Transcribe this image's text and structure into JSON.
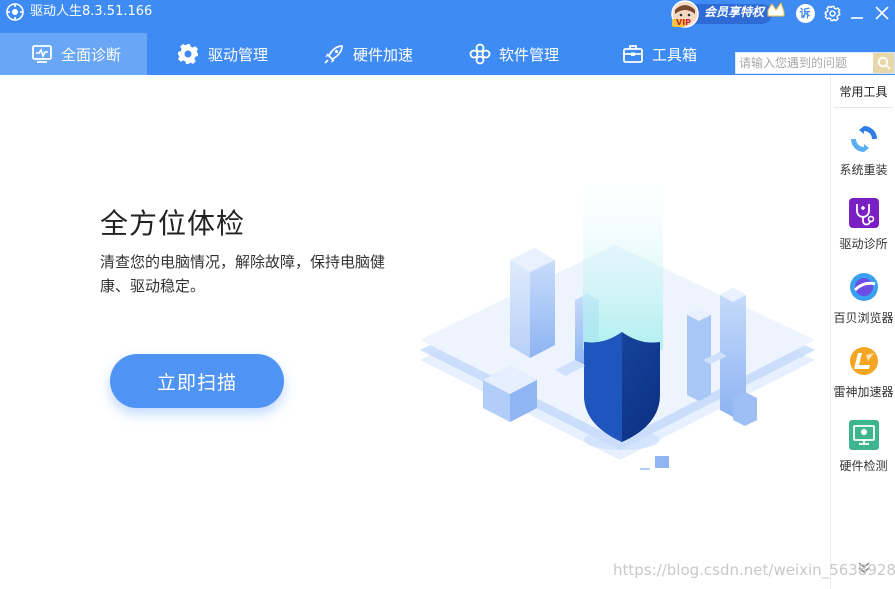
{
  "app": {
    "title": "驱动人生8.3.51.166"
  },
  "vip": {
    "label": "会员享特权",
    "badge": "VIP"
  },
  "window_controls": {
    "service_badge": "诉"
  },
  "tabs": [
    {
      "label": "全面诊断",
      "icon": "monitor-check-icon",
      "active": true
    },
    {
      "label": "驱动管理",
      "icon": "gear-icon",
      "active": false
    },
    {
      "label": "硬件加速",
      "icon": "rocket-icon",
      "active": false
    },
    {
      "label": "软件管理",
      "icon": "flower-apps-icon",
      "active": false
    },
    {
      "label": "工具箱",
      "icon": "toolbox-icon",
      "active": false
    }
  ],
  "search": {
    "placeholder": "请输入您遇到的问题",
    "value": ""
  },
  "main": {
    "headline": "全方位体检",
    "description": "清查您的电脑情况，解除故障，保持电脑健康、驱动稳定。",
    "scan_button": "立即扫描"
  },
  "sidebar": {
    "title": "常用工具",
    "tools": [
      {
        "label": "系统重装",
        "icon": "system-reinstall-icon"
      },
      {
        "label": "驱动诊所",
        "icon": "driver-clinic-icon"
      },
      {
        "label": "百贝浏览器",
        "icon": "browser-icon"
      },
      {
        "label": "雷神加速器",
        "icon": "leishen-accelerator-icon"
      },
      {
        "label": "硬件检测",
        "icon": "hardware-check-icon"
      }
    ]
  },
  "watermark": "https://blog.csdn.net/weixin_5638928",
  "colors": {
    "header": "#3f8bf4",
    "active_tab": "#6aa6f6",
    "scan_button": "#4f94f5"
  }
}
